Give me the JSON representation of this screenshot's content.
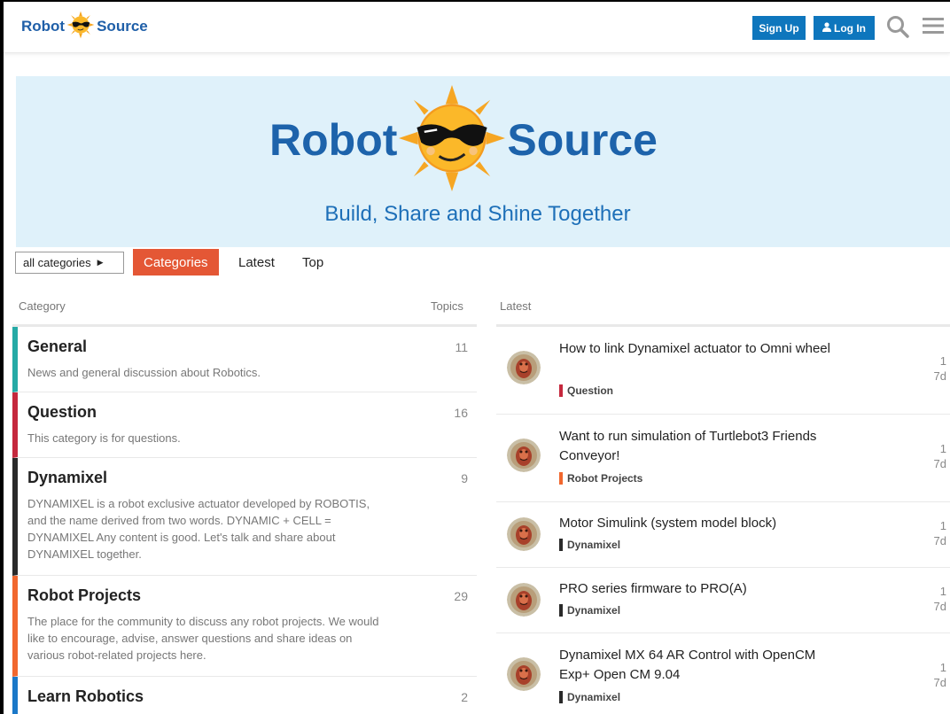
{
  "header": {
    "logo_left": "Robot",
    "logo_right": "Source",
    "signup_label": "Sign Up",
    "login_label": "Log In",
    "search_icon": "search-icon",
    "menu_icon": "hamburger-menu-icon"
  },
  "banner": {
    "logo_left": "Robot",
    "logo_right": "Source",
    "tagline": "Build, Share and Shine Together"
  },
  "nav": {
    "dropdown_label": "all categories",
    "tabs": [
      "Categories",
      "Latest",
      "Top"
    ]
  },
  "columns": {
    "category": "Category",
    "topics": "Topics",
    "latest": "Latest"
  },
  "categories": [
    {
      "name": "General",
      "count": "11",
      "description": "News and general discussion about Robotics.",
      "color": "#25aaa6"
    },
    {
      "name": "Question",
      "count": "16",
      "description": "This category is for questions.",
      "color": "#c5283d"
    },
    {
      "name": "Dynamixel",
      "count": "9",
      "description": "DYNAMIXEL is a robot exclusive actuator developed by ROBOTIS, and the name derived from two words. DYNAMIC + CELL = DYNAMIXEL Any content is good. Let's talk and share about DYNAMIXEL together.",
      "color": "#2a2a2a"
    },
    {
      "name": "Robot Projects",
      "count": "29",
      "description": "The place for the community to discuss any robot projects. We would like to encourage, advise, answer questions and share ideas on various robot-related projects here.",
      "color": "#f1672e"
    },
    {
      "name": "Learn Robotics",
      "count": "2",
      "description": "",
      "color": "#1b78c8"
    }
  ],
  "topics": [
    {
      "title": "How to link Dynamixel actuator to Omni wheel",
      "category": "Question",
      "category_color": "#c5283d",
      "replies": "1",
      "age": "7d"
    },
    {
      "title": "Want to run simulation of Turtlebot3 Friends Conveyor!",
      "category": "Robot Projects",
      "category_color": "#f1672e",
      "replies": "1",
      "age": "7d"
    },
    {
      "title": "Motor Simulink (system model block)",
      "category": "Dynamixel",
      "category_color": "#2a2a2a",
      "replies": "1",
      "age": "7d"
    },
    {
      "title": "PRO series firmware to PRO(A)",
      "category": "Dynamixel",
      "category_color": "#2a2a2a",
      "replies": "1",
      "age": "7d"
    },
    {
      "title": "Dynamixel MX 64 AR Control with OpenCM Exp+ Open CM 9.04",
      "category": "Dynamixel",
      "category_color": "#2a2a2a",
      "replies": "1",
      "age": "7d"
    }
  ]
}
